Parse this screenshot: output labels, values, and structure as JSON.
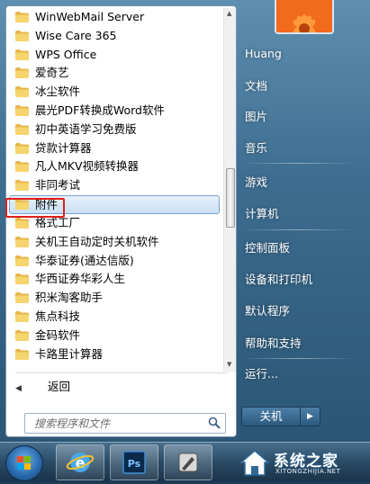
{
  "programs": [
    {
      "label": "WinWebMail Server"
    },
    {
      "label": "Wise Care 365"
    },
    {
      "label": "WPS Office"
    },
    {
      "label": "爱奇艺"
    },
    {
      "label": "冰尘软件"
    },
    {
      "label": "晨光PDF转换成Word软件"
    },
    {
      "label": "初中英语学习免费版"
    },
    {
      "label": "贷款计算器"
    },
    {
      "label": "凡人MKV视频转换器"
    },
    {
      "label": "非同考试"
    },
    {
      "label": "附件",
      "selected": true
    },
    {
      "label": "格式工厂"
    },
    {
      "label": "关机王自动定时关机软件"
    },
    {
      "label": "华泰证券(通达信版)"
    },
    {
      "label": "华西证券华彩人生"
    },
    {
      "label": "积米淘客助手"
    },
    {
      "label": "焦点科技"
    },
    {
      "label": "金码软件"
    },
    {
      "label": "卡路里计算器"
    }
  ],
  "back_label": "返回",
  "search": {
    "placeholder": "搜索程序和文件"
  },
  "right_menu": {
    "user": "Huang",
    "documents": "文档",
    "pictures": "图片",
    "music": "音乐",
    "games": "游戏",
    "computer": "计算机",
    "control_panel": "控制面板",
    "devices_printers": "设备和打印机",
    "default_programs": "默认程序",
    "help_support": "帮助和支持",
    "run": "运行..."
  },
  "shutdown_label": "关机",
  "watermark": {
    "text": "系统之家",
    "sub": "XITONGZHIJIA.NET"
  },
  "colors": {
    "selection_border": "#e0201b",
    "accent": "#2b5675"
  },
  "icons": {
    "folder": "folder-icon",
    "search": "search-icon",
    "back": "back-arrow-icon"
  }
}
